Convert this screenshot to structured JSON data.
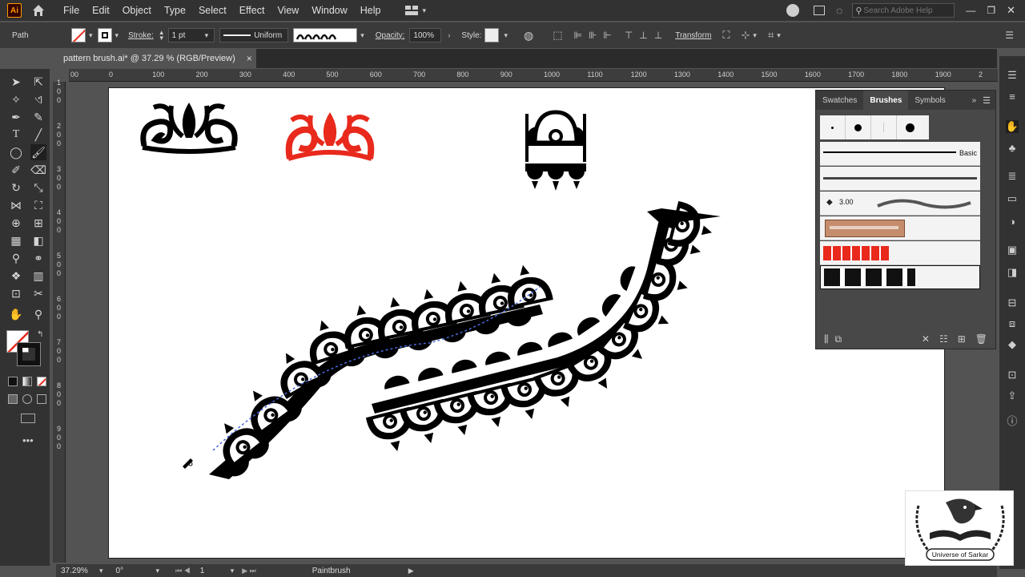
{
  "app": {
    "logo": "Ai",
    "home_icon": "home-icon"
  },
  "menu": [
    "File",
    "Edit",
    "Object",
    "Type",
    "Select",
    "Effect",
    "View",
    "Window",
    "Help"
  ],
  "search": {
    "placeholder": "Search Adobe Help"
  },
  "control": {
    "selection_type": "Path",
    "stroke_label": "Stroke:",
    "stroke_weight": "1 pt",
    "stroke_profile": "Uniform",
    "opacity_label": "Opacity:",
    "opacity_value": "100%",
    "style_label": "Style:",
    "transform_label": "Transform"
  },
  "document_tab": {
    "title": "pattern brush.ai* @ 37.29 % (RGB/Preview)",
    "close": "×"
  },
  "rulers": {
    "top": [
      "00",
      "0",
      "100",
      "200",
      "300",
      "400",
      "500",
      "600",
      "700",
      "800",
      "900",
      "1000",
      "1100",
      "1200",
      "1300",
      "1400",
      "1500",
      "1600",
      "1700",
      "1800",
      "1900",
      "2"
    ],
    "left": [
      "1",
      "0",
      "0",
      "2",
      "0",
      "0",
      "3",
      "0",
      "0",
      "4",
      "0",
      "0",
      "5",
      "0",
      "0",
      "6",
      "0",
      "0",
      "7",
      "0",
      "0",
      "8",
      "0",
      "0",
      "9",
      "0",
      "0"
    ]
  },
  "panel": {
    "tabs": [
      "Swatches",
      "Brushes",
      "Symbols"
    ],
    "active_tab": "Brushes",
    "basic_label": "Basic",
    "calligraphic_size": "3.00"
  },
  "status": {
    "zoom": "37.29%",
    "rotation": "0°",
    "artboard": "1",
    "current_tool": "Paintbrush"
  },
  "watermark": {
    "text": "Universe of Sarkar"
  },
  "colors": {
    "accent_red": "#e8291c",
    "ui_dark": "#323232",
    "canvas_bg": "#535353"
  }
}
